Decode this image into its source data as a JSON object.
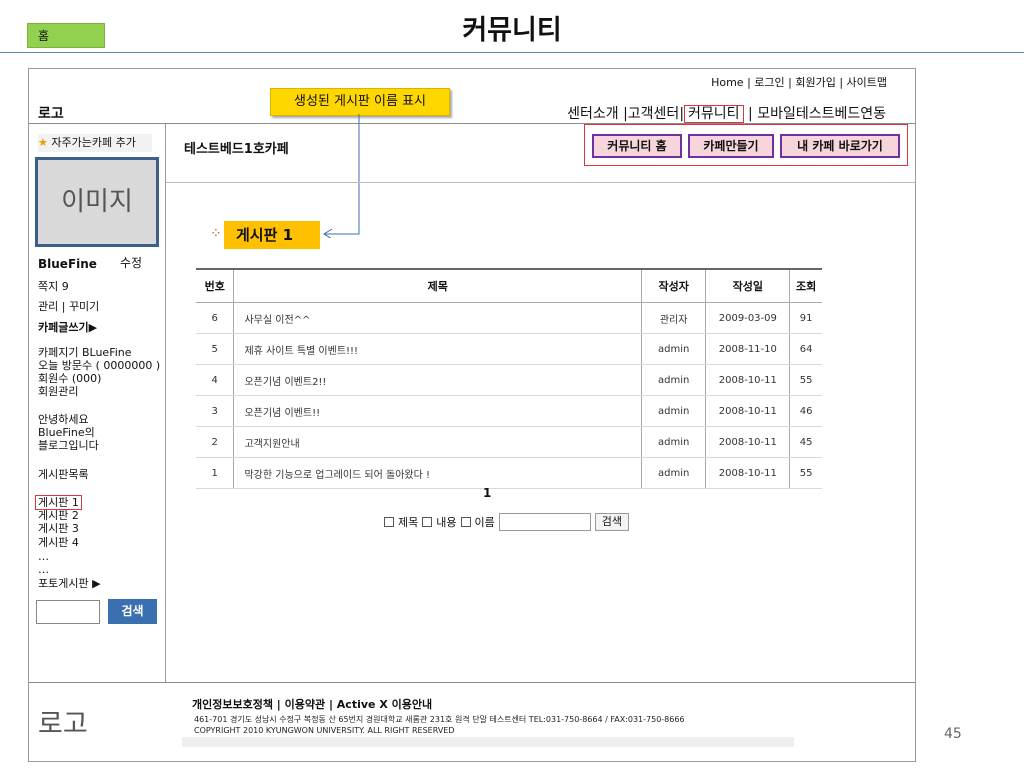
{
  "slide": {
    "home_tab": "홈",
    "title": "커뮤니티",
    "page_number": "45"
  },
  "header": {
    "top_links": "Home | 로그인 | 회원가입 | 사이트맵",
    "logo": "로고",
    "nav_left": "센터소개 |고객센터|",
    "nav_active": "커뮤니티",
    "nav_right": " | 모바일테스트베드연동"
  },
  "annotation": {
    "callout": "생성된 게시판 이름 표시"
  },
  "sidebar": {
    "favorite": "자주가는카페 추가",
    "image_placeholder": "이미지",
    "username": "BlueFine",
    "edit": "수정",
    "messages": "쪽지 9",
    "manage": "관리 | 꾸미기",
    "write": "카페글쓰기▶",
    "keeper": "카페지기 BLueFine",
    "visitors_today": "오늘 방문수 ( 0000000 )",
    "members": "회원수 (000)",
    "member_manage": "회원관리",
    "greeting_1": "안녕하세요",
    "greeting_2": "BlueFine의",
    "greeting_3": "블로그입니다",
    "board_list_title": "게시판목록",
    "boards": [
      "게시판 1",
      "게시판 2",
      "게시판 3",
      "게시판 4",
      "…",
      "…"
    ],
    "photo_board": "포토게시판 ▶",
    "search_button": "검색"
  },
  "main": {
    "cafe_name": "테스트베드1호카페",
    "buttons": [
      "커뮤니티 홈",
      "카페만들기",
      "내 카페 바로가기"
    ],
    "board_label": "게시판 1",
    "columns": [
      "번호",
      "제목",
      "작성자",
      "작성일",
      "조회"
    ],
    "rows": [
      {
        "no": "6",
        "title": "사무실 이전^^",
        "author": "관리자",
        "date": "2009-03-09",
        "views": "91"
      },
      {
        "no": "5",
        "title": "제휴 사이트 특별 이벤트!!!",
        "author": "admin",
        "date": "2008-11-10",
        "views": "64"
      },
      {
        "no": "4",
        "title": "오픈기념 이벤트2!!",
        "author": "admin",
        "date": "2008-10-11",
        "views": "55"
      },
      {
        "no": "3",
        "title": "오픈기념 이벤트!!",
        "author": "admin",
        "date": "2008-10-11",
        "views": "46"
      },
      {
        "no": "2",
        "title": "고객지원안내",
        "author": "admin",
        "date": "2008-10-11",
        "views": "45"
      },
      {
        "no": "1",
        "title": "막강한 기능으로 업그레이드 되어 돌아왔다 !",
        "author": "admin",
        "date": "2008-10-11",
        "views": "55"
      }
    ],
    "pagination": "1",
    "search_options": [
      "제목",
      "내용",
      "이름"
    ],
    "search_button": "검색"
  },
  "footer": {
    "logo": "로고",
    "links": "개인정보보호정책 | 이용약관 | Active X 이용안내",
    "address": "461-701 경기도 성남시 수정구 복정동 산 65번지 경원대학교 새롬관 231호 원격 단말 테스트센터 TEL:031-750-8664 / FAX:031-750-8666",
    "copyright": "COPYRIGHT 2010 KYUNGWON UNIVERSITY. ALL RIGHT RESERVED"
  }
}
